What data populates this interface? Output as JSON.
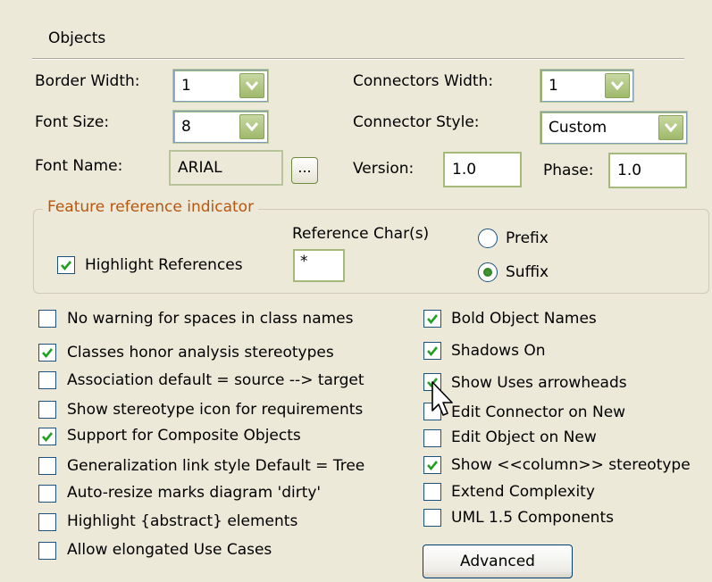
{
  "objects_group": {
    "title": "Objects"
  },
  "fields": {
    "border_width": {
      "label": "Border Width:",
      "value": "1"
    },
    "connectors_width": {
      "label": "Connectors Width:",
      "value": "1"
    },
    "font_size": {
      "label": "Font Size:",
      "value": "8"
    },
    "connector_style": {
      "label": "Connector Style:",
      "value": "Custom"
    },
    "font_name": {
      "label": "Font Name:",
      "value": "ARIAL",
      "button_label": "..."
    },
    "version": {
      "label": "Version:",
      "value": "1.0"
    },
    "phase": {
      "label": "Phase:",
      "value": "1.0"
    }
  },
  "feature_reference": {
    "legend": "Feature reference indicator",
    "highlight_label": "Highlight References",
    "highlight_checked": true,
    "ref_chars_label": "Reference Char(s)",
    "ref_chars_value": "*",
    "prefix_label": "Prefix",
    "suffix_label": "Suffix",
    "selected": "Suffix"
  },
  "left_options": [
    {
      "label": "No warning for spaces in class names",
      "checked": false
    },
    {
      "label": "Classes honor analysis stereotypes",
      "checked": true
    },
    {
      "label": "Association default = source --> target",
      "checked": false
    },
    {
      "label": "Show stereotype icon for requirements",
      "checked": false
    },
    {
      "label": "Support for Composite Objects",
      "checked": true
    },
    {
      "label": "Generalization link style Default = Tree",
      "checked": false
    },
    {
      "label": "Auto-resize marks diagram 'dirty'",
      "checked": false
    },
    {
      "label": "Highlight {abstract} elements",
      "checked": false
    },
    {
      "label": "Allow elongated Use Cases",
      "checked": false
    }
  ],
  "right_options": [
    {
      "label": "Bold Object Names",
      "checked": true
    },
    {
      "label": "Shadows On",
      "checked": true
    },
    {
      "label": "Show Uses arrowheads",
      "checked": true
    },
    {
      "label": "Edit Connector on New",
      "checked": false
    },
    {
      "label": "Edit Object on New",
      "checked": false
    },
    {
      "label": "Show <<column>> stereotype",
      "checked": true
    },
    {
      "label": "Extend Complexity",
      "checked": false
    },
    {
      "label": "UML 1.5 Components",
      "checked": false
    }
  ],
  "advanced_button": "Advanced",
  "colors": {
    "background": "#ece9d8",
    "legend": "#b8560f",
    "check": "#21a121"
  }
}
